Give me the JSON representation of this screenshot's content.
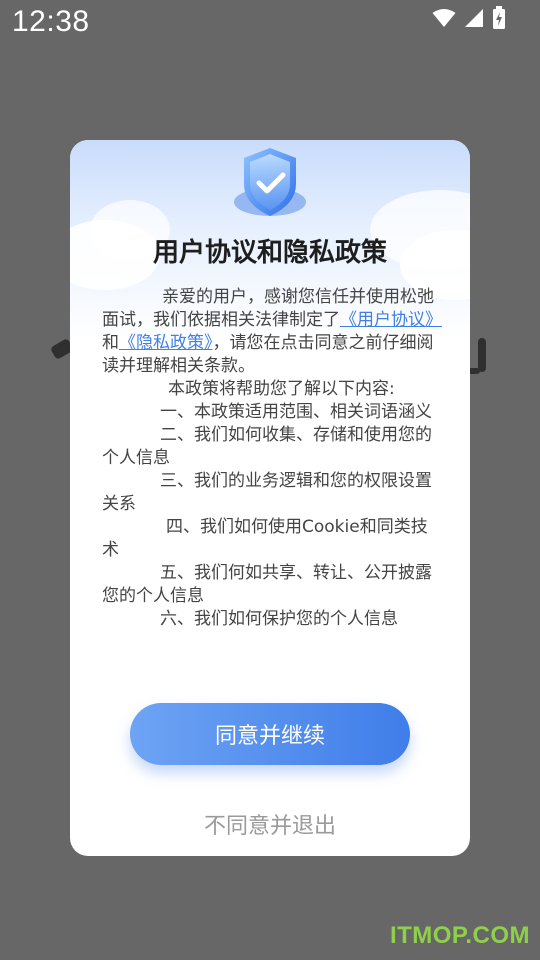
{
  "status_bar": {
    "time": "12:38"
  },
  "dialog": {
    "title": "用户协议和隐私政策",
    "intro_before": "亲爱的用户，感谢您信任并使用松弛面试，我们依据相关法律制定了",
    "user_agreement_link": "《用户协议》",
    "conjunction": "和",
    "privacy_policy_link": "《隐私政策》",
    "intro_after": "，请您在点击同意之前仔细阅读并理解相关条款。",
    "policy_intro": "本政策将帮助您了解以下内容:",
    "sections": [
      "一、本政策适用范围、相关词语涵义",
      "二、我们如何收集、存储和使用您的个人信息",
      "三、我们的业务逻辑和您的权限设置关系",
      "四、我们如何使用Cookie和同类技术",
      "五、我们何如共享、转让、公开披露您的个人信息",
      "六、我们如何保护您的个人信息"
    ],
    "agree_label": "同意并继续",
    "disagree_label": "不同意并退出"
  },
  "watermark": "ITMOP.COM",
  "colors": {
    "overlay": "#676767",
    "accent": "#3f7fe8",
    "button_gradient_start": "#6ea4f4",
    "button_gradient_end": "#3f7de9",
    "watermark": "#8ed04a"
  },
  "icons": [
    "wifi-icon",
    "signal-icon",
    "battery-charging-icon",
    "shield-check-icon"
  ]
}
